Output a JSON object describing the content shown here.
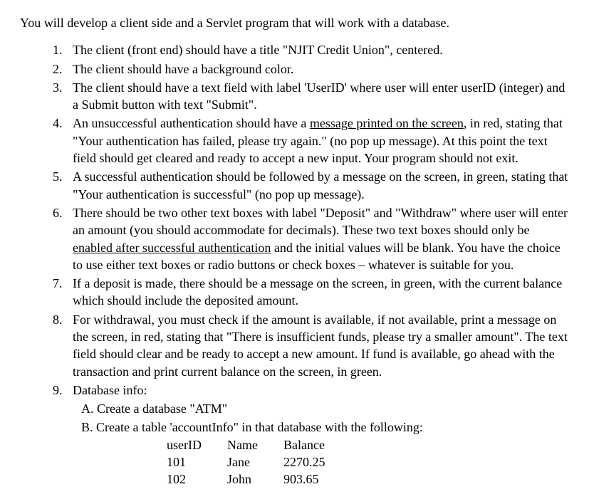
{
  "intro": "You will develop a client side and a Servlet program that will work with a database.",
  "items": {
    "i1": "The client (front end) should have a title \"NJIT Credit Union\", centered.",
    "i2": "The client should have a background color.",
    "i3": "The client should have a text field with label 'UserID' where user will enter userID (integer) and a Submit button with text \"Submit\".",
    "i4_a": "An unsuccessful authentication should have a ",
    "i4_u": "message printed on the screen",
    "i4_b": ", in red, stating that \"Your authentication has failed, please try again.\" (no pop up message). At this point the text field should get cleared and ready to accept a new input. Your program should not exit.",
    "i5": "A successful authentication should be followed by a message on the screen, in green, stating that \"Your authentication is successful\" (no pop up message).",
    "i6_a": "There should be two other text boxes with label \"Deposit\" and \"Withdraw\" where user will enter an amount (you should accommodate for decimals). These two text boxes should only be ",
    "i6_u": "enabled after successful authentication",
    "i6_b": " and the initial values will be blank. You have the choice to use either text boxes or radio buttons or check boxes – whatever is suitable for you.",
    "i7": "If a deposit is made, there should be a message on the screen, in green, with the current balance which should include the deposited amount.",
    "i8": "For withdrawal, you must check if the amount is available, if not available, print a message on the screen, in red, stating that \"There is insufficient funds, please try a smaller amount\". The text field should clear and be ready to accept a new amount. If fund is available, go ahead with the transaction and print current balance on the screen, in green.",
    "i9": "Database info:",
    "i9A": "A. Create a database \"ATM\"",
    "i9B": "B. Create a table 'accountInfo\" in that database with the following:"
  },
  "table": {
    "headers": {
      "c1": "userID",
      "c2": "Name",
      "c3": "Balance"
    },
    "rows": [
      {
        "c1": "101",
        "c2": "Jane",
        "c3": "2270.25"
      },
      {
        "c1": "102",
        "c2": "John",
        "c3": "903.65"
      }
    ]
  }
}
